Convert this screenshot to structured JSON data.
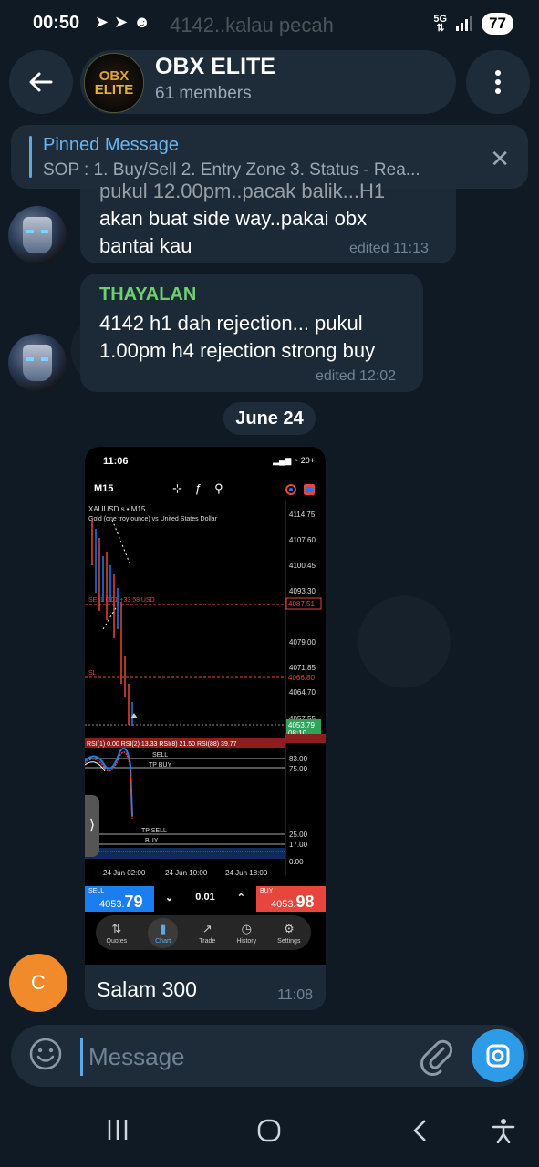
{
  "status_bar": {
    "time": "00:50",
    "ghost_text": "4142..kalau pecah",
    "network": "5G",
    "battery": "77"
  },
  "header": {
    "logo_line1": "OBX",
    "logo_line2": "ELITE",
    "title": "OBX ELITE",
    "subtitle": "61 members"
  },
  "pinned": {
    "label": "Pinned Message",
    "text": "SOP : 1. Buy/Sell 2. Entry Zone 3. Status - Rea..."
  },
  "messages": [
    {
      "lines": [
        "pukul 12.00pm..pacak balik...H1",
        "akan buat side way..pakai obx",
        "bantai kau"
      ],
      "meta": "edited 11:13"
    },
    {
      "sender": "THAYALAN",
      "lines": [
        "4142 h1 dah rejection... pukul",
        "1.00pm h4 rejection strong buy"
      ],
      "meta": "edited 12:02"
    }
  ],
  "date_chip": "June 24",
  "screenshot": {
    "time": "11:06",
    "status_right": "20+",
    "timeframe": "M15",
    "symbol": "XAUUSD.s • M15",
    "description": "Gold (one troy ounce) vs United States Dollar",
    "price_ticks": [
      "4114.75",
      "4107.60",
      "4100.45",
      "4093.30",
      "4087.51",
      "4079.00",
      "4071.85",
      "4066.80",
      "4064.70",
      "4057.55",
      "4053.79",
      "08:10"
    ],
    "profit_label": "SELL 0.01 +33.58 USD",
    "sl_label": "SL",
    "rsi_label": "RSI(1) 0.00 RSI(2) 13.33 RSI(8) 21.50 RSI(88) 39.77",
    "osc_ticks": [
      "83.00",
      "75.00",
      "25.00",
      "17.00",
      "0.00"
    ],
    "osc_lines": [
      "SELL",
      "TP BUY",
      "TP SELL",
      "BUY"
    ],
    "time_axis": [
      "24 Jun 02:00",
      "24 Jun 10:00",
      "24 Jun 18:00"
    ],
    "sell_label": "SELL",
    "sell_price_small": "4053.",
    "sell_price_big": "79",
    "buy_label": "BUY",
    "buy_price_small": "4053.",
    "buy_price_big": "98",
    "lot": "0.01",
    "nav": [
      "Quotes",
      "Chart",
      "Trade",
      "History",
      "Settings"
    ]
  },
  "photo_caption": "Salam 300",
  "photo_time": "11:08",
  "avatar_initial": "C",
  "composer": {
    "placeholder": "Message"
  }
}
